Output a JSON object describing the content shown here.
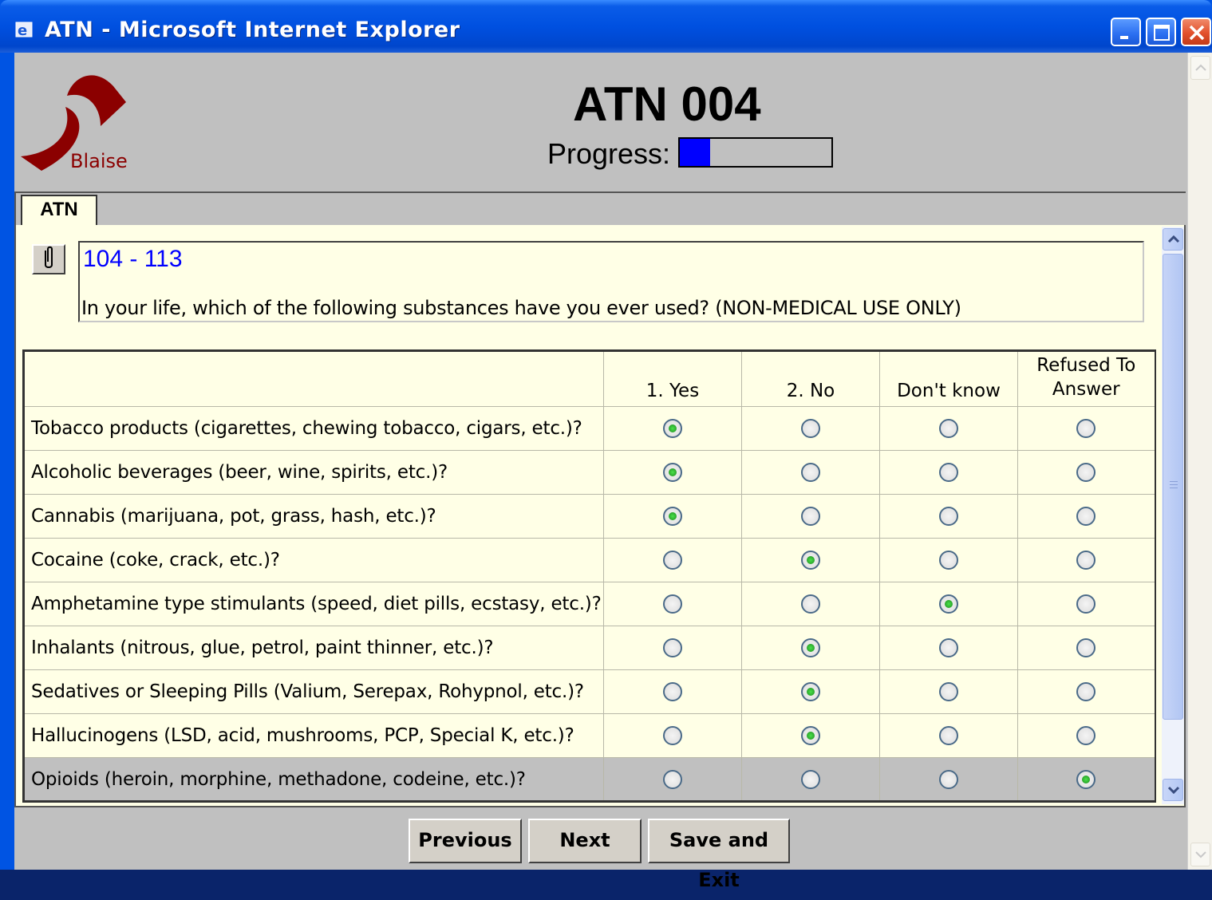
{
  "window": {
    "title": "ATN - Microsoft Internet Explorer"
  },
  "header": {
    "logo_text": "Blaise",
    "title": "ATN 004",
    "progress_label": "Progress:",
    "progress_fraction": 0.2
  },
  "tabs": [
    {
      "label": "ATN"
    }
  ],
  "question": {
    "attach_icon": "paperclip-icon",
    "range": "104 - 113",
    "text": "In your life, which of the following substances have you ever used? (NON-MEDICAL USE ONLY)"
  },
  "grid": {
    "columns": [
      "",
      "1. Yes",
      "2. No",
      "Don't know",
      "Refused To Answer"
    ],
    "rows": [
      {
        "label": "Tobacco products (cigarettes, chewing tobacco, cigars, etc.)?",
        "selected": 0
      },
      {
        "label": "Alcoholic beverages (beer, wine, spirits, etc.)?",
        "selected": 0
      },
      {
        "label": "Cannabis (marijuana, pot, grass, hash, etc.)?",
        "selected": 0
      },
      {
        "label": "Cocaine (coke, crack, etc.)?",
        "selected": 1
      },
      {
        "label": "Amphetamine type stimulants (speed, diet pills, ecstasy, etc.)?",
        "selected": 2
      },
      {
        "label": "Inhalants (nitrous, glue, petrol, paint thinner, etc.)?",
        "selected": 1
      },
      {
        "label": "Sedatives or Sleeping Pills (Valium, Serepax, Rohypnol, etc.)?",
        "selected": 1
      },
      {
        "label": "Hallucinogens (LSD, acid, mushrooms, PCP, Special K, etc.)?",
        "selected": 1
      },
      {
        "label": "Opioids (heroin, morphine, methadone, codeine, etc.)?",
        "selected": 3,
        "current": true
      }
    ]
  },
  "buttons": {
    "previous": "Previous",
    "next": "Next",
    "save_exit": "Save and Exit"
  },
  "colors": {
    "titlebar": "#0050e0",
    "accent_blue": "#0000ff",
    "logo_red": "#8b0000",
    "panel_bg": "#ffffe6"
  }
}
